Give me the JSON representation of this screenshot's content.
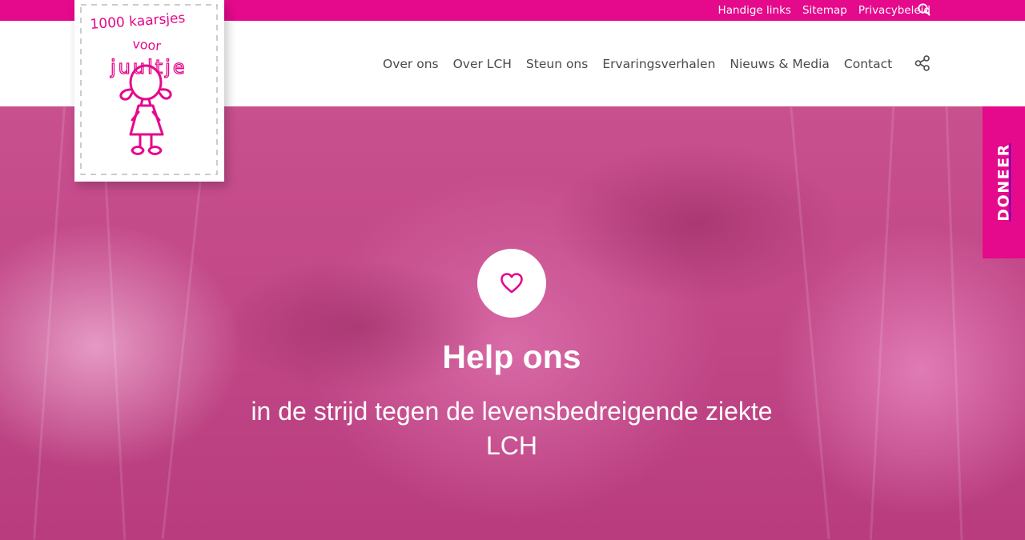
{
  "topbar": {
    "links": [
      "Handige links",
      "Sitemap",
      "Privacybeleid"
    ],
    "search_icon": "search-icon"
  },
  "logo": {
    "text_line1": "1000 kaarsjes",
    "text_line2": "voor",
    "text_line3": "juultje"
  },
  "nav": {
    "items": [
      "Over ons",
      "Over LCH",
      "Steun ons",
      "Ervaringsverhalen",
      "Nieuws & Media",
      "Contact"
    ],
    "share_icon": "share-icon"
  },
  "hero": {
    "icon": "heart-icon",
    "title": "Help ons",
    "subtitle": "in de strijd tegen de levensbedreigende ziekte LCH"
  },
  "donate": {
    "label": "DONEER"
  },
  "colors": {
    "brand": "#e5098b",
    "nav_text": "#4a4a4a",
    "hero_overlay": "#c04686"
  }
}
